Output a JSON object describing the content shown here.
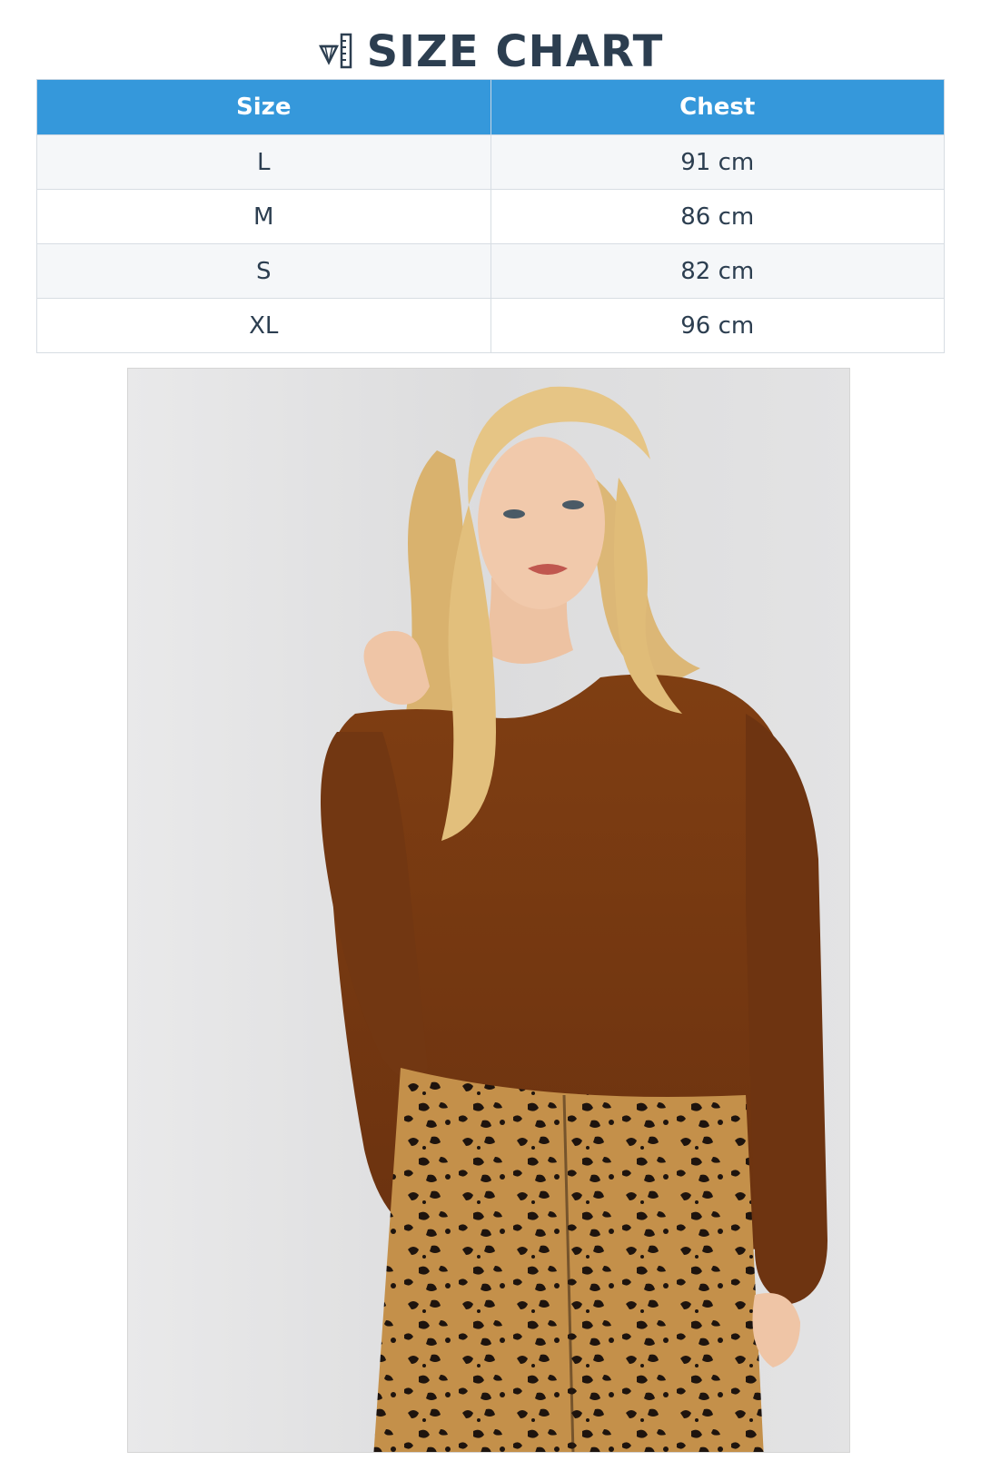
{
  "header": {
    "title": "SIZE CHART",
    "icon": "diamond-ruler-icon",
    "color": "#2c3e50"
  },
  "size_table": {
    "header_color": "#3598db",
    "columns": [
      "Size",
      "Chest"
    ],
    "rows": [
      {
        "size": "L",
        "chest": "91 cm"
      },
      {
        "size": "M",
        "chest": "86 cm"
      },
      {
        "size": "S",
        "chest": "82 cm"
      },
      {
        "size": "XL",
        "chest": "96 cm"
      }
    ]
  },
  "product_photo": {
    "subject": "model-wearing-brown-sweater",
    "colors": {
      "sweater": "#7a3b10",
      "hair": "#e7c788",
      "pattern": "#c7924b"
    }
  }
}
